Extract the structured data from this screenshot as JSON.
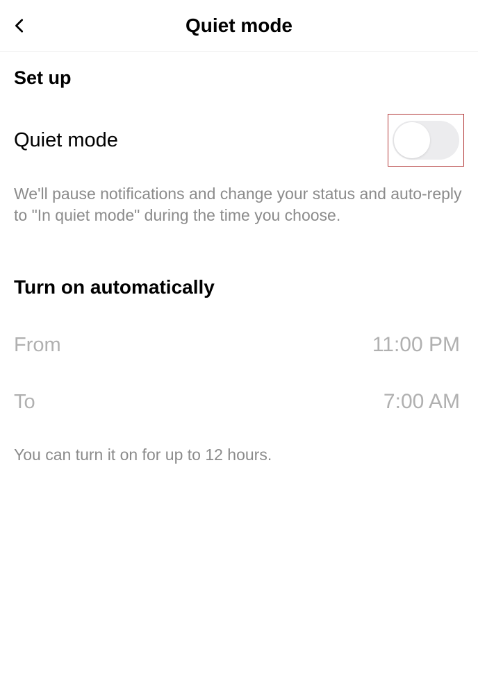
{
  "header": {
    "title": "Quiet mode"
  },
  "setup": {
    "section_title": "Set up",
    "toggle_label": "Quiet mode",
    "toggle_on": false,
    "description": "We'll pause notifications and change your status and auto-reply to \"In quiet mode\" during the time you choose."
  },
  "schedule": {
    "section_title": "Turn on automatically",
    "from_label": "From",
    "from_value": "11:00 PM",
    "to_label": "To",
    "to_value": "7:00 AM",
    "note": "You can turn it on for up to 12 hours."
  }
}
